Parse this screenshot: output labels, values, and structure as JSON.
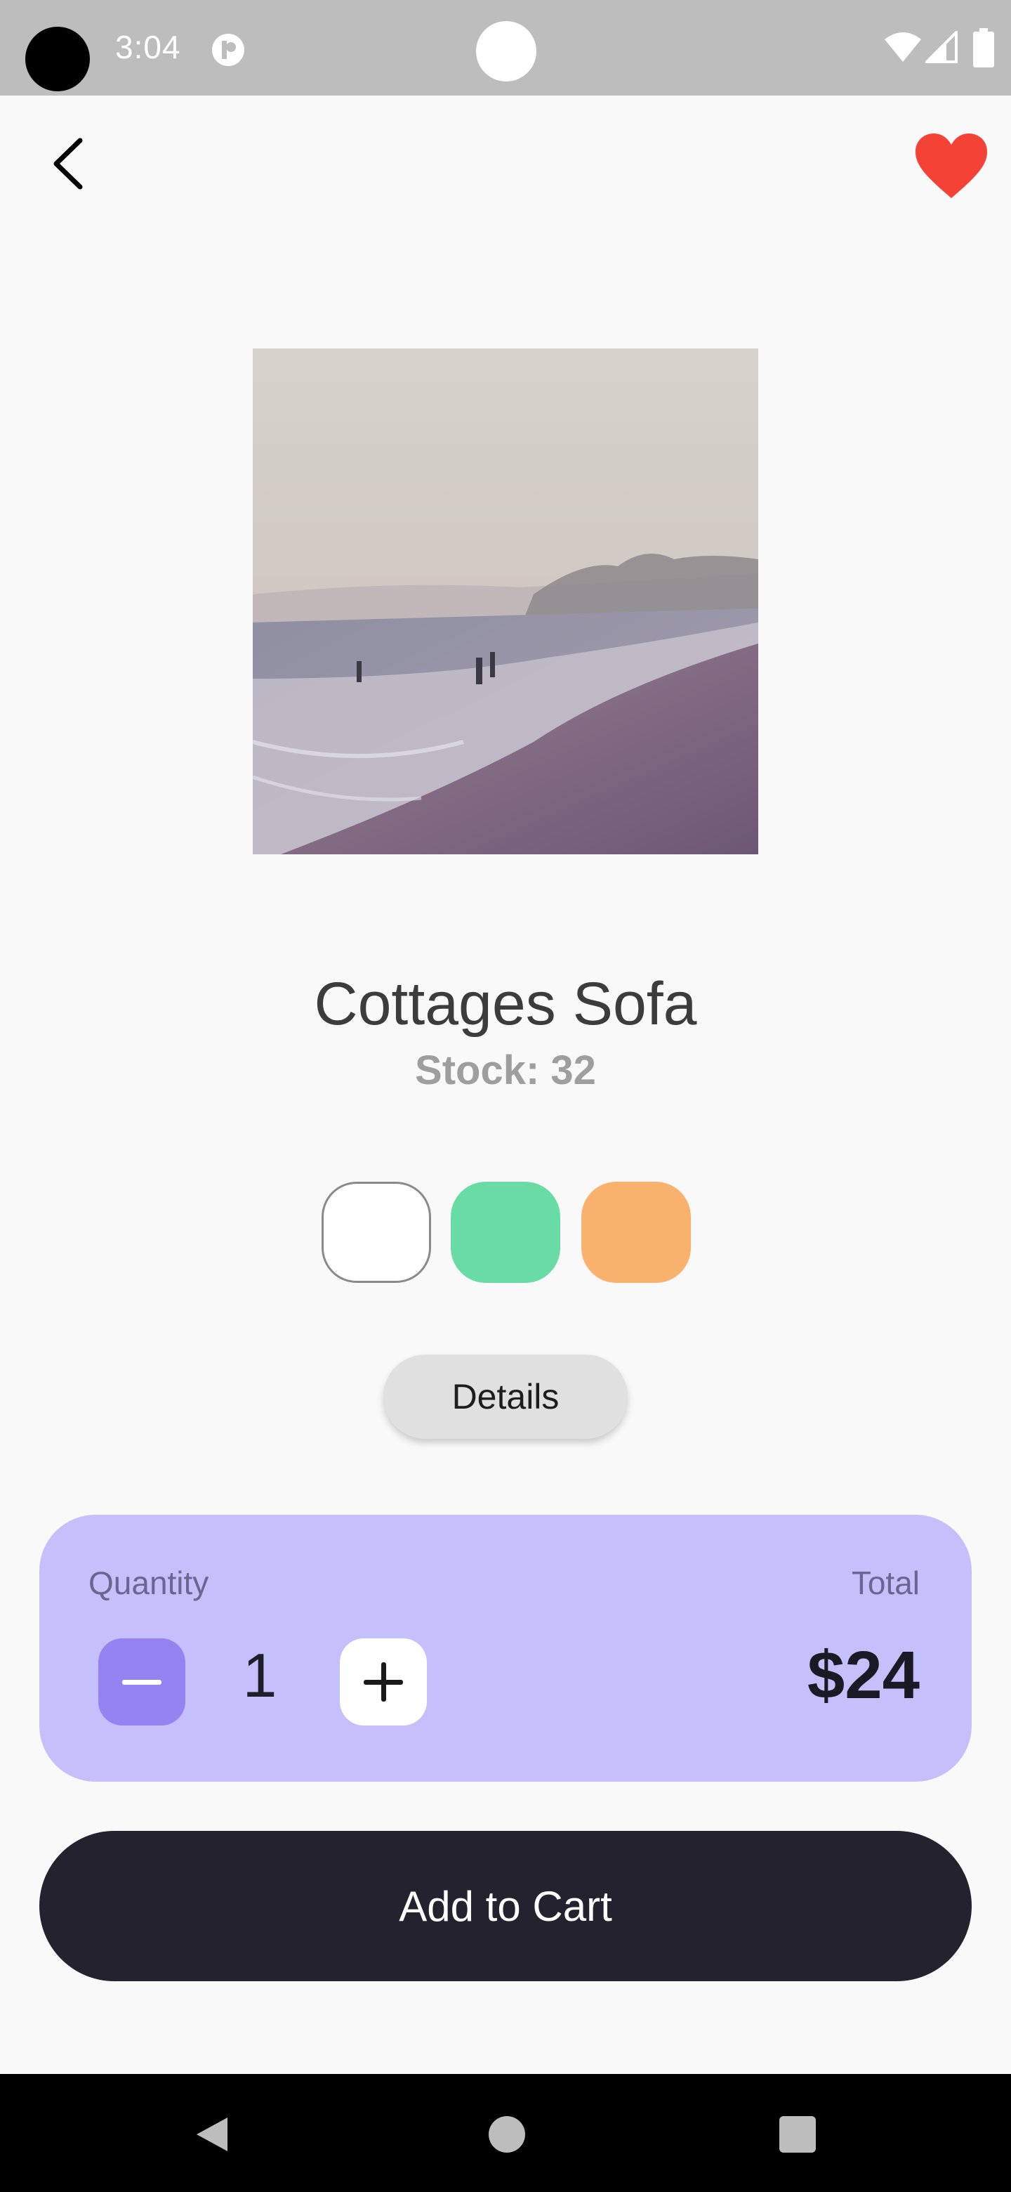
{
  "status_bar": {
    "time": "3:04"
  },
  "product": {
    "title": "Cottages Sofa",
    "stock": "Stock: 32",
    "image_icon": "beach-photo",
    "favorite": true
  },
  "colors": [
    "#ffffff",
    "#69dba4",
    "#f8b26d"
  ],
  "details_label": "Details",
  "quantity": {
    "label": "Quantity",
    "value": "1",
    "total_label": "Total",
    "total_value": "$24"
  },
  "add_to_cart_label": "Add to Cart",
  "accent": {
    "card": "#c5bffc",
    "minus": "#9583f2",
    "heart": "#f44336",
    "button": "#23222e"
  }
}
